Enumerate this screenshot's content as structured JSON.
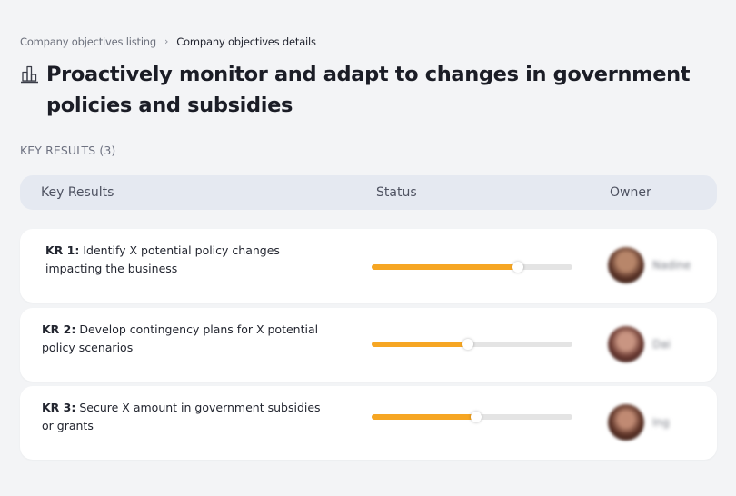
{
  "breadcrumb": {
    "parent": "Company objectives listing",
    "separator": "›",
    "current": "Company objectives details"
  },
  "objective": {
    "icon": "building-chart-icon",
    "title": "Proactively monitor and adapt to changes in government policies and subsidies"
  },
  "key_results_section": {
    "label": "KEY RESULTS (3)"
  },
  "table": {
    "headers": {
      "key_results": "Key Results",
      "status": "Status",
      "owner": "Owner"
    },
    "rows": [
      {
        "label": "KR 1:",
        "description": "Identify X potential policy changes impacting the business",
        "progress": 0.73,
        "owner_name": "Nadine"
      },
      {
        "label": "KR 2:",
        "description": "Develop contingency plans for X potential policy scenarios",
        "progress": 0.48,
        "owner_name": "Dai"
      },
      {
        "label": "KR 3:",
        "description": "Secure X amount in government subsidies or grants",
        "progress": 0.52,
        "owner_name": "Ing"
      }
    ]
  },
  "colors": {
    "page_background": "#f3f4f6",
    "header_background": "#e5e9f1",
    "progress_fill": "#f6a623",
    "progress_track": "#e4e4e4"
  }
}
